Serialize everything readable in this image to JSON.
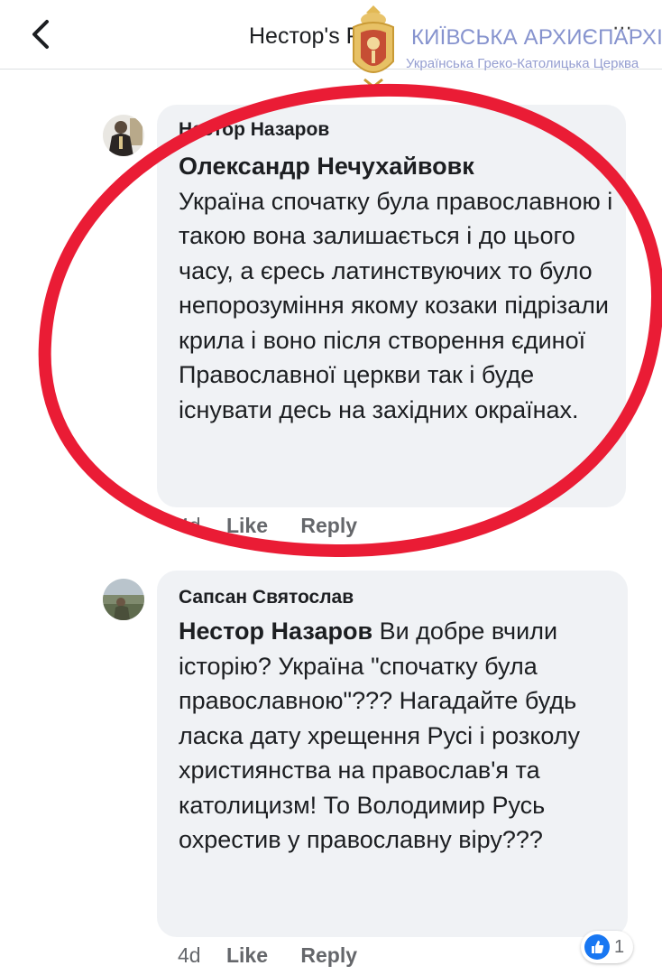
{
  "header": {
    "title": "Нестор's Post",
    "back_icon": "chevron-left-icon",
    "more_icon": "more-dots-icon"
  },
  "watermark": {
    "title": "КИЇВСЬКА АРХИЄПАРХІЯ",
    "subtitle": "Українська Греко-Католицька Церква"
  },
  "comments": [
    {
      "author": "Нестор Назаров",
      "mention": "Олександр Нечухайвовк",
      "text": "Україна спочатку була православною і такою вона залишається і до цього часу, а єресь латинствуючих то було непорозуміння якому козаки підрізали крила і воно після створення єдиної Православної церкви так і буде існувати десь на західних окраїнах.",
      "time": "4d",
      "like_label": "Like",
      "reply_label": "Reply"
    },
    {
      "author": "Сапсан Святослав",
      "mention": "Нестор Назаров",
      "text": "Ви добре вчили історію? Україна \"спочатку була православною\"??? Нагадайте будь ласка дату хрещення Русі і розколу християнства на православ'я та католицизм! То Володимир Русь охрестив у православну віру???",
      "time": "4d",
      "like_label": "Like",
      "reply_label": "Reply",
      "reaction_count": "1",
      "reaction_icon": "like-thumb-icon"
    }
  ],
  "colors": {
    "bubble": "#f0f2f5",
    "meta_text": "#65676b",
    "annotation_ellipse": "#ea1c35",
    "facebook_blue": "#1877f2"
  }
}
